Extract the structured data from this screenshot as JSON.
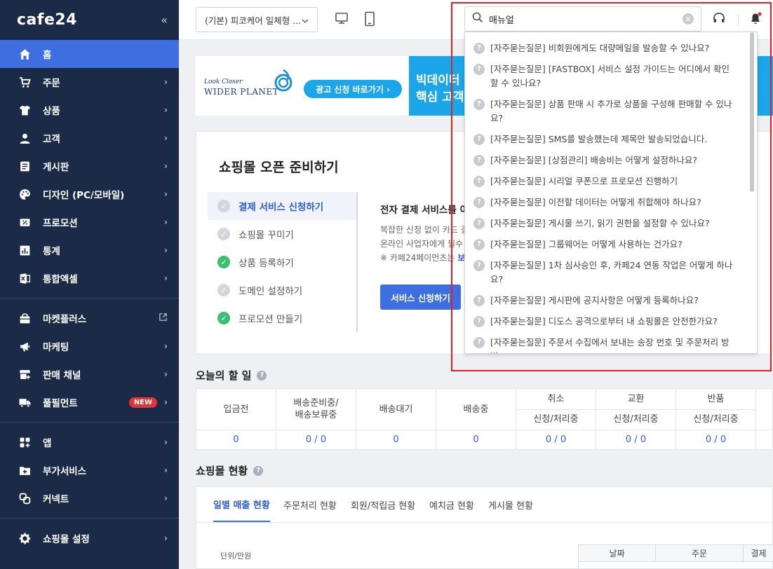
{
  "sidebar": {
    "logo": "cafe24",
    "collapse": "«",
    "items": [
      {
        "label": "홈",
        "active": true
      },
      {
        "label": "주문"
      },
      {
        "label": "상품"
      },
      {
        "label": "고객"
      },
      {
        "label": "게시판"
      },
      {
        "label": "디자인 (PC/모바일)"
      },
      {
        "label": "프로모션"
      },
      {
        "label": "통계"
      },
      {
        "label": "통합엑셀"
      }
    ],
    "items2": [
      {
        "label": "마켓플러스"
      },
      {
        "label": "마케팅"
      },
      {
        "label": "판매 채널"
      },
      {
        "label": "풀필먼트",
        "badge": "NEW"
      }
    ],
    "items3": [
      {
        "label": "앱"
      },
      {
        "label": "부가서비스"
      },
      {
        "label": "커넥트"
      }
    ],
    "items4": [
      {
        "label": "쇼핑몰 설정"
      }
    ]
  },
  "topbar": {
    "shop_select": "(기본) 피코케어 일체형 ...",
    "search_value": "매뉴얼"
  },
  "banner": {
    "brand_small": "Look Closer",
    "brand": "WIDER PLANET",
    "cta": "광고 신청 바로가기 ›",
    "right_line1": "빅데이터 기",
    "right_line2": "핵심 고객"
  },
  "onboarding": {
    "title": "쇼핑몰 오픈 준비하기",
    "steps": [
      {
        "label": "결제 서비스 신청하기",
        "state": "active"
      },
      {
        "label": "쇼핑몰 꾸미기",
        "state": "todo"
      },
      {
        "label": "상품 등록하기",
        "state": "done"
      },
      {
        "label": "도메인 설정하기",
        "state": "todo"
      },
      {
        "label": "프로모션 만들기",
        "state": "done"
      }
    ],
    "detail_head": "전자 결제 서비스를 이",
    "detail_line1": "복잡한 신청 없이 카드 결",
    "detail_line2": "온라인 사업자에게 필수",
    "detail_line3_prefix": "※ 카페24페이먼츠는 ",
    "detail_line3_link": "보",
    "button": "서비스 신청하기"
  },
  "todo": {
    "title": "오늘의 할 일",
    "help": "?",
    "cols": [
      {
        "label": "입금전",
        "value": "0"
      },
      {
        "label": "배송준비중/\n배송보류중",
        "value": "0 / 0"
      },
      {
        "label": "배송대기",
        "value": "0"
      },
      {
        "label": "배송중",
        "value": "0"
      },
      {
        "group": "취소",
        "label": "신청/처리중",
        "value": "0 / 0"
      },
      {
        "group": "교환",
        "label": "신청/처리중",
        "value": "0 / 0"
      },
      {
        "group": "반품",
        "label": "신청/처리중",
        "value": "0 / 0"
      }
    ]
  },
  "status": {
    "title": "쇼핑몰 현황",
    "help": "?",
    "tabs": [
      "일별 매출 현황",
      "주문처리 현황",
      "회원/적립금 현황",
      "예치금 현황",
      "게시물 현황"
    ],
    "unit": "단위/만원",
    "table_headers": [
      "날짜",
      "주문",
      "결제"
    ]
  },
  "dropdown": {
    "items": [
      "[자주묻는질문] 비회원에게도 대량메일을 발송할 수 있나요?",
      "[자주묻는질문] [FASTBOX] 서비스 설정 가이드는 어디에서 확인할 수 있나요?",
      "[자주묻는질문] 상품 판매 시 추가로 상품을 구성해 판매할 수 있나요?",
      "[자주묻는질문] SMS를 발송했는데 제목만 발송되었습니다.",
      "[자주묻는질문] [상점관리] 배송비는 어떻게 설정하나요?",
      "[자주묻는질문] 시리얼 쿠폰으로 프로모션 진행하기",
      "[자주묻는질문] 이전할 데이터는 어떻게 취합해야 하나요?",
      "[자주묻는질문] 게시물 쓰기, 읽기 권한을 설정할 수 있나요?",
      "[자주묻는질문] 그룹웨어는 어떻게 사용하는 건가요?",
      "[자주묻는질문] 1차 심사승인 후, 카페24 연동 작업은 어떻게 하나요?",
      "[자주묻는질문] 게시판에 공지사항은 어떻게 등록하나요?",
      "[자주묻는질문] 디도스 공격으로부터 내 쇼핑몰은 안전한가요?",
      "[자주묻는질문] 주문서 수집에서 보내는 송장 번호 및 주문처리 방법"
    ],
    "q_icon": "?"
  },
  "colors": {
    "sidebar": "#1b2a46",
    "accent": "#3d6fe0",
    "highlight": "#e32020",
    "success": "#3bbf73"
  }
}
